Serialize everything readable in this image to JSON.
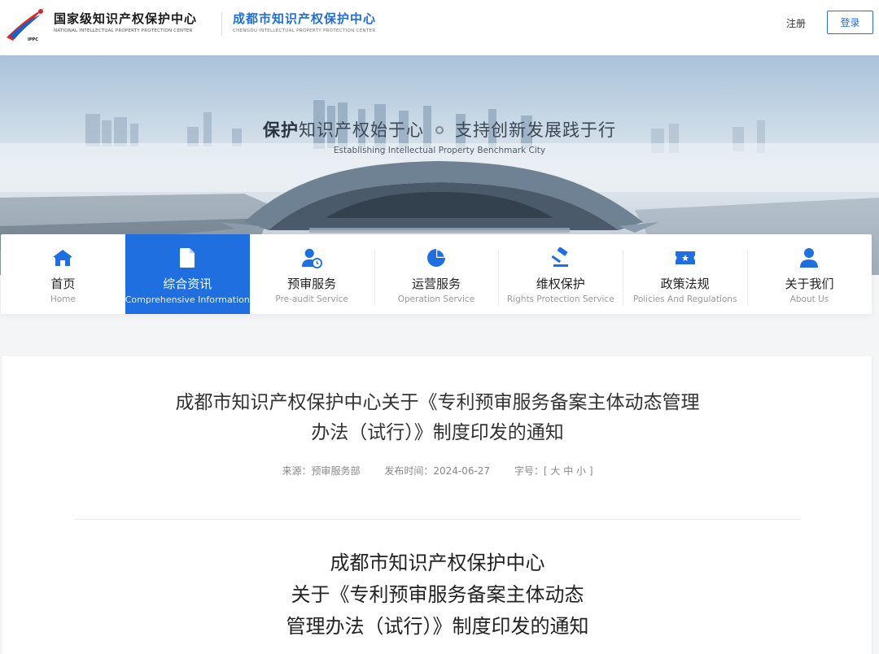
{
  "header": {
    "logo_primary_cn": "国家级知识产权保护中心",
    "logo_primary_en": "NATIONAL INTELLECTUAL PROPERTY PROTECTION CENTER",
    "logo_badge": "IPPC",
    "logo_secondary_cn": "成都市知识产权保护中心",
    "logo_secondary_en": "CHENGDU INTELLECTUAL PROPERTY PROTECTION CENTER",
    "register_label": "注册",
    "login_label": "登录"
  },
  "banner": {
    "slogan_bold": "保护",
    "slogan_part1": "知识产权始于心",
    "slogan_part2": "支持创新发展践于行",
    "slogan_en": "Establishing Intellectual Property Benchmark City"
  },
  "nav": {
    "items": [
      {
        "cn": "首页",
        "en": "Home",
        "icon": "home-icon"
      },
      {
        "cn": "综合资讯",
        "en": "Comprehensive Information",
        "icon": "document-icon",
        "active": true
      },
      {
        "cn": "预审服务",
        "en": "Pre-audit Service",
        "icon": "user-clock-icon"
      },
      {
        "cn": "运营服务",
        "en": "Operation Service",
        "icon": "pie-chart-icon"
      },
      {
        "cn": "维权保护",
        "en": "Rights Protection Service",
        "icon": "gavel-icon"
      },
      {
        "cn": "政策法规",
        "en": "Policies And Regulations",
        "icon": "ticket-icon"
      },
      {
        "cn": "关于我们",
        "en": "About Us",
        "icon": "user-icon"
      }
    ]
  },
  "article": {
    "title_line1": "成都市知识产权保护中心关于《专利预审服务备案主体动态管理",
    "title_line2": "办法（试行）》制度印发的通知",
    "meta": {
      "source": "来源：预审服务部",
      "date": "发布时间：2024-06-27",
      "font_size_label": "字号：[ 大 中 小 ]"
    },
    "body_title_line1": "成都市知识产权保护中心",
    "body_title_line2": "关于《专利预审服务备案主体动态",
    "body_title_line3": "管理办法（试行）》制度印发的通知"
  },
  "colors": {
    "accent": "#1f6fe0",
    "icon_blue": "#1f6fe0",
    "logo_red": "#d62a2a",
    "secondary_brand": "#1f6fd6"
  }
}
